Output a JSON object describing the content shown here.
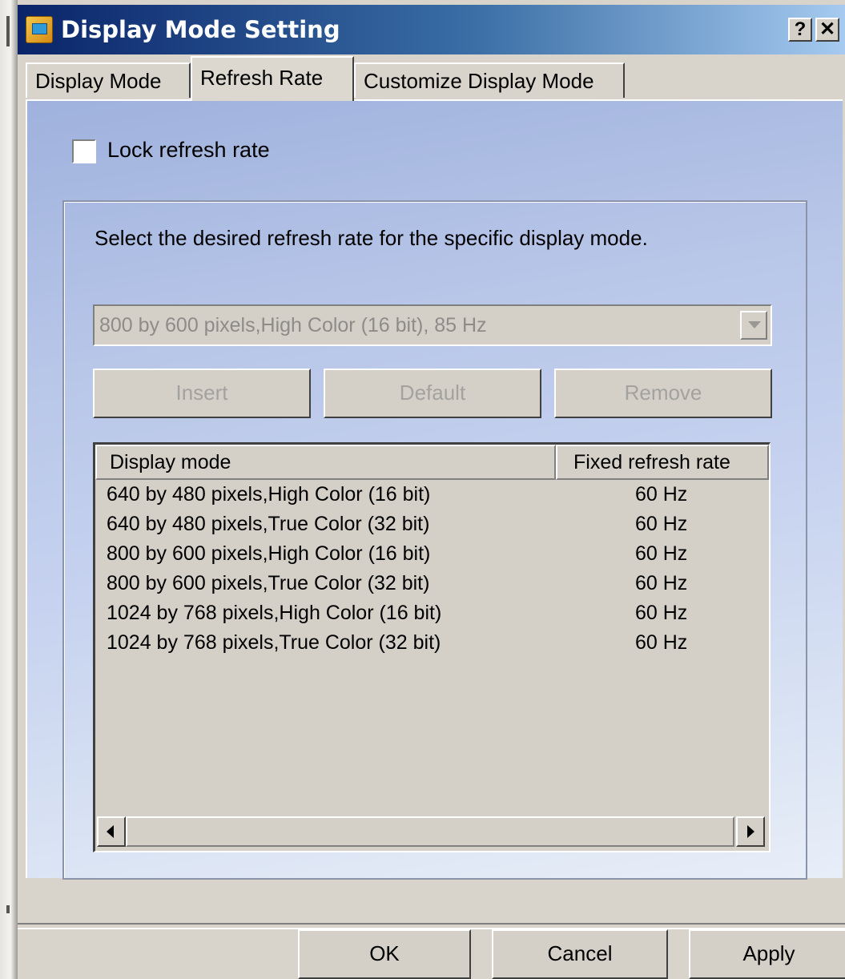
{
  "window": {
    "title": "Display Mode Setting",
    "help_label": "?",
    "close_label": "✕"
  },
  "tabs": [
    {
      "label": "Display Mode",
      "active": false
    },
    {
      "label": "Refresh Rate",
      "active": true
    },
    {
      "label": "Customize Display Mode",
      "active": false
    }
  ],
  "lock": {
    "label": "Lock  refresh rate",
    "checked": false
  },
  "group": {
    "instruction": "Select the desired refresh rate for the specific display mode.",
    "combo_value": "800 by 600 pixels,High Color (16 bit), 85 Hz",
    "buttons": {
      "insert": "Insert",
      "default": "Default",
      "remove": "Remove"
    }
  },
  "list": {
    "columns": {
      "mode": "Display mode",
      "rate": "Fixed refresh rate"
    },
    "rows": [
      {
        "mode": "640 by 480 pixels,High Color (16 bit)",
        "rate": "60 Hz"
      },
      {
        "mode": "640 by 480 pixels,True Color (32 bit)",
        "rate": "60 Hz"
      },
      {
        "mode": "800 by 600 pixels,High Color (16 bit)",
        "rate": "60 Hz"
      },
      {
        "mode": "800 by 600 pixels,True Color (32 bit)",
        "rate": "60 Hz"
      },
      {
        "mode": "1024 by 768 pixels,High Color (16 bit)",
        "rate": "60 Hz"
      },
      {
        "mode": "1024 by 768 pixels,True Color (32 bit)",
        "rate": "60 Hz"
      }
    ]
  },
  "footer": {
    "ok": "OK",
    "cancel": "Cancel",
    "apply": "Apply"
  },
  "colors": {
    "titlebar_start": "#0a246a",
    "titlebar_end": "#a6caf0",
    "panel_bg": "#b8c6e8",
    "disabled_text": "#a4a29e"
  }
}
